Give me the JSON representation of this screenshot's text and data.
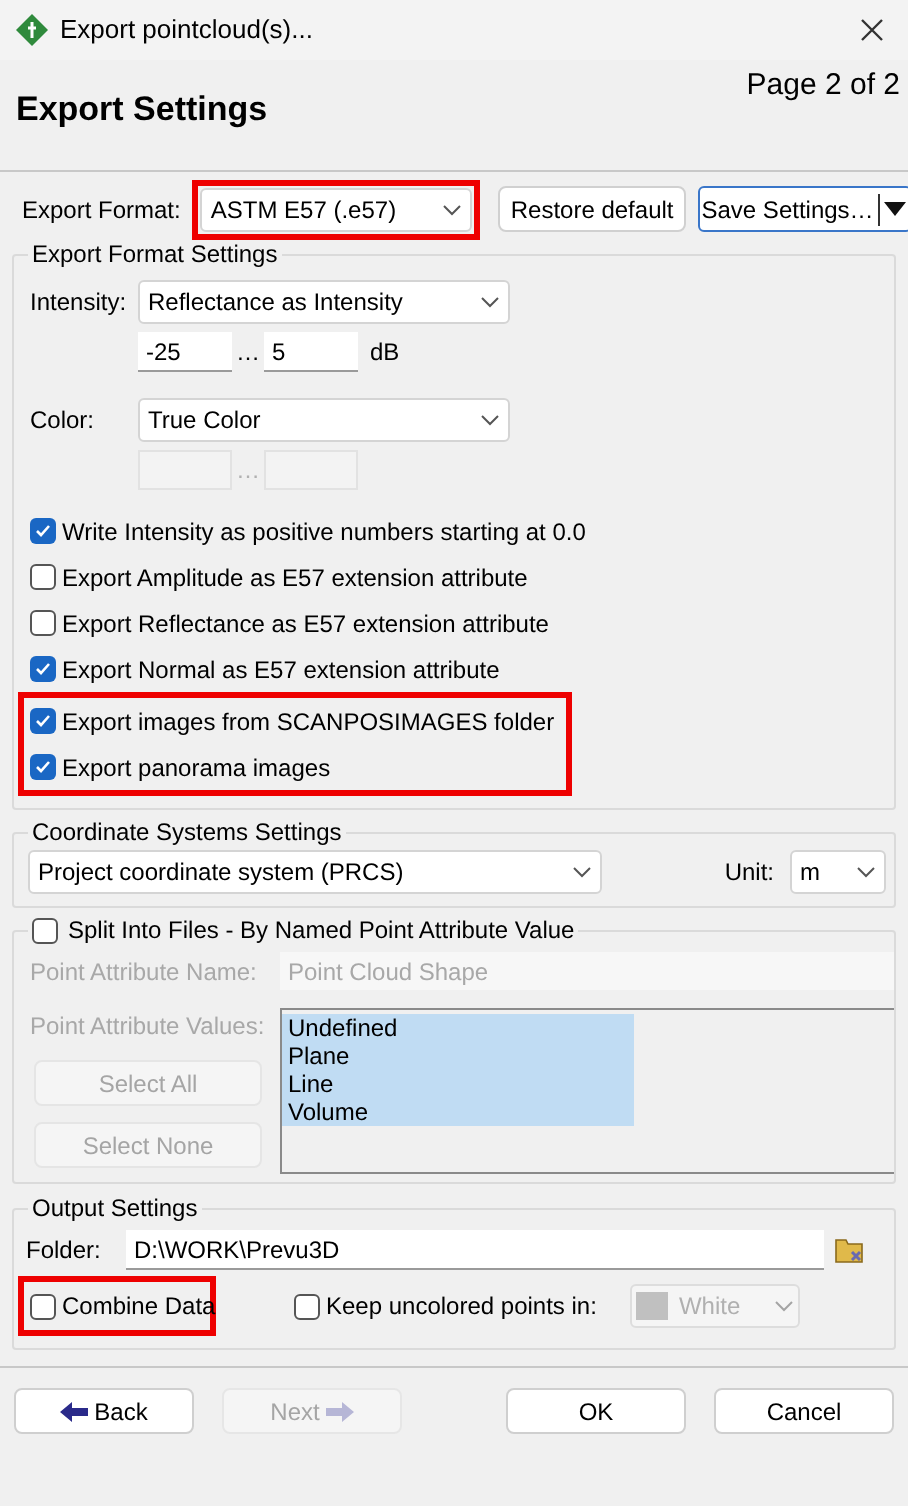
{
  "window": {
    "title": "Export pointcloud(s)..."
  },
  "header": {
    "title": "Export Settings",
    "page": "Page 2 of 2"
  },
  "format": {
    "label": "Export Format:",
    "value": "ASTM E57 (.e57)",
    "highlighted": true
  },
  "format_buttons": [
    {
      "kind": "button",
      "label": "Restore default"
    },
    {
      "kind": "split",
      "label": "Save Settings…"
    }
  ],
  "format_settings": {
    "title": "Export Format Settings",
    "intensity": {
      "label": "Intensity:",
      "value": "Reflectance as Intensity",
      "min": "-25",
      "separator": "…",
      "max": "5",
      "unit": "dB"
    },
    "color": {
      "label": "Color:",
      "value": "True Color",
      "separator": "…",
      "disabled": true
    },
    "options": [
      {
        "label": "Write Intensity as positive numbers starting at 0.0",
        "checked": true,
        "highlighted": false
      },
      {
        "label": "Export Amplitude as E57 extension attribute",
        "checked": false,
        "highlighted": false
      },
      {
        "label": "Export Reflectance as E57 extension attribute",
        "checked": false,
        "highlighted": false
      },
      {
        "label": "Export Normal as E57 extension attribute",
        "checked": true,
        "highlighted": false
      },
      {
        "label": "Export images from SCANPOSIMAGES folder",
        "checked": true,
        "highlighted": true
      },
      {
        "label": "Export panorama images",
        "checked": true,
        "highlighted": true
      }
    ]
  },
  "coordinate_settings": {
    "title": "Coordinate Systems Settings",
    "system": "Project coordinate system (PRCS)",
    "unit_label": "Unit:",
    "unit": "m"
  },
  "split": {
    "title": "Split Into Files - By Named Point Attribute Value",
    "checked": false,
    "name_label": "Point Attribute Name:",
    "name_value": "Point Cloud Shape",
    "values_label": "Point Attribute Values:",
    "values": [
      {
        "label": "Undefined",
        "selected": true
      },
      {
        "label": "Plane",
        "selected": true
      },
      {
        "label": "Line",
        "selected": true
      },
      {
        "label": "Volume",
        "selected": true
      }
    ],
    "buttons": [
      "Select All",
      "Select None"
    ]
  },
  "output": {
    "title": "Output Settings",
    "folder_label": "Folder:",
    "folder": "D:\\WORK\\Prevu3D",
    "combine": {
      "label": "Combine Data",
      "checked": false,
      "highlighted": true
    },
    "keep": {
      "label": "Keep uncolored points in:",
      "checked": false,
      "color_value": "White",
      "color": "#c0c0c0"
    }
  },
  "nav": [
    {
      "kind": "back",
      "label": "Back",
      "disabled": false
    },
    {
      "kind": "next",
      "label": "Next",
      "disabled": true
    },
    {
      "kind": "plain",
      "label": "OK",
      "disabled": false
    },
    {
      "kind": "plain",
      "label": "Cancel",
      "disabled": false
    }
  ]
}
